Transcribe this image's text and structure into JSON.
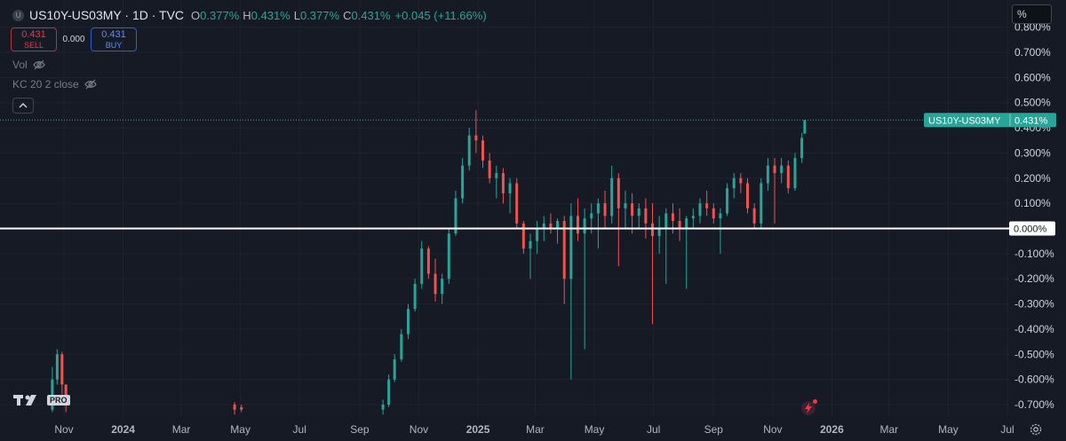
{
  "header": {
    "symbol_badge": "U",
    "title": "US10Y-US03MY · 1D · TVC",
    "open_label": "O",
    "open": "0.377%",
    "high_label": "H",
    "high": "0.431%",
    "low_label": "L",
    "low": "0.377%",
    "close_label": "C",
    "close": "0.431%",
    "change": "+0.045 (+11.66%)"
  },
  "trade": {
    "sell_price": "0.431",
    "sell_label": "SELL",
    "spread": "0.000",
    "buy_price": "0.431",
    "buy_label": "BUY"
  },
  "indicators": [
    {
      "label": "Vol"
    },
    {
      "label": "KC 20 2 close"
    }
  ],
  "unit_selector": "%",
  "price_label": {
    "symbol": "US10Y-US03MY",
    "value": "0.431%"
  },
  "zero_label": "0.000%",
  "logo_text": "PRO",
  "colors": {
    "background": "#161a25",
    "up": "#26a69a",
    "down": "#ef5350",
    "grid": "#1f2330",
    "zero_line": "#ffffff"
  },
  "chart_data": {
    "type": "candlestick",
    "title": "US10Y-US03MY",
    "ylabel": "%",
    "ylim": [
      -0.72,
      0.81
    ],
    "y_ticks": [
      "0.800%",
      "0.700%",
      "0.600%",
      "0.500%",
      "0.400%",
      "0.300%",
      "0.200%",
      "0.100%",
      "-0.100%",
      "-0.200%",
      "-0.300%",
      "-0.400%",
      "-0.500%",
      "-0.600%",
      "-0.700%"
    ],
    "y_tick_values": [
      0.8,
      0.7,
      0.6,
      0.5,
      0.4,
      0.3,
      0.2,
      0.1,
      -0.1,
      -0.2,
      -0.3,
      -0.4,
      -0.5,
      -0.6,
      -0.7
    ],
    "x_ticks": [
      "Nov",
      "2024",
      "Mar",
      "May",
      "Jul",
      "Sep",
      "Nov",
      "2025",
      "Mar",
      "May",
      "Jul",
      "Sep",
      "Nov",
      "2026",
      "Mar",
      "May",
      "Jul"
    ],
    "x_tick_dates": [
      "2023-11-01",
      "2024-01-01",
      "2024-03-01",
      "2024-05-01",
      "2024-07-01",
      "2024-09-01",
      "2024-11-01",
      "2025-01-01",
      "2025-03-01",
      "2025-05-01",
      "2025-07-01",
      "2025-09-01",
      "2025-11-01",
      "2026-01-01",
      "2026-03-01",
      "2026-05-01",
      "2026-07-01"
    ],
    "horizontal_line": 0,
    "last_value": 0.431,
    "grid": true,
    "series": [
      {
        "name": "US10Y-US03MY",
        "data": [
          [
            "2023-10-20",
            -0.72,
            -0.55,
            -0.73,
            -0.6
          ],
          [
            "2023-10-25",
            -0.6,
            -0.48,
            -0.62,
            -0.5
          ],
          [
            "2023-10-30",
            -0.5,
            -0.49,
            -0.66,
            -0.62
          ],
          [
            "2023-11-03",
            -0.62,
            -0.68,
            -0.73,
            -0.7
          ],
          [
            "2024-04-25",
            -0.7,
            -0.69,
            -0.74,
            -0.72
          ],
          [
            "2024-05-02",
            -0.71,
            -0.7,
            -0.73,
            -0.72
          ],
          [
            "2024-09-25",
            -0.72,
            -0.68,
            -0.74,
            -0.7
          ],
          [
            "2024-10-01",
            -0.7,
            -0.58,
            -0.71,
            -0.6
          ],
          [
            "2024-10-07",
            -0.6,
            -0.5,
            -0.61,
            -0.52
          ],
          [
            "2024-10-14",
            -0.52,
            -0.4,
            -0.53,
            -0.42
          ],
          [
            "2024-10-21",
            -0.42,
            -0.3,
            -0.44,
            -0.32
          ],
          [
            "2024-10-28",
            -0.32,
            -0.2,
            -0.33,
            -0.22
          ],
          [
            "2024-11-04",
            -0.22,
            -0.05,
            -0.24,
            -0.08
          ],
          [
            "2024-11-11",
            -0.08,
            -0.07,
            -0.2,
            -0.18
          ],
          [
            "2024-11-18",
            -0.18,
            -0.12,
            -0.29,
            -0.26
          ],
          [
            "2024-11-25",
            -0.26,
            -0.18,
            -0.3,
            -0.2
          ],
          [
            "2024-12-02",
            -0.2,
            0.0,
            -0.22,
            -0.02
          ],
          [
            "2024-12-09",
            -0.02,
            0.15,
            -0.03,
            0.12
          ],
          [
            "2024-12-16",
            0.12,
            0.28,
            0.1,
            0.25
          ],
          [
            "2024-12-23",
            0.25,
            0.4,
            0.23,
            0.37
          ],
          [
            "2024-12-30",
            0.37,
            0.47,
            0.3,
            0.35
          ],
          [
            "2025-01-06",
            0.35,
            0.37,
            0.24,
            0.27
          ],
          [
            "2025-01-13",
            0.27,
            0.3,
            0.18,
            0.2
          ],
          [
            "2025-01-20",
            0.2,
            0.25,
            0.12,
            0.22
          ],
          [
            "2025-01-27",
            0.22,
            0.24,
            0.1,
            0.14
          ],
          [
            "2025-02-03",
            0.14,
            0.2,
            0.06,
            0.18
          ],
          [
            "2025-02-10",
            0.18,
            0.2,
            0.0,
            0.02
          ],
          [
            "2025-02-17",
            0.02,
            0.03,
            -0.1,
            -0.08
          ],
          [
            "2025-02-24",
            -0.08,
            -0.02,
            -0.2,
            -0.05
          ],
          [
            "2025-03-03",
            -0.05,
            0.03,
            -0.1,
            0.0
          ],
          [
            "2025-03-10",
            0.0,
            0.05,
            -0.05,
            0.02
          ],
          [
            "2025-03-17",
            0.02,
            0.06,
            -0.02,
            0.0
          ],
          [
            "2025-03-24",
            0.0,
            0.04,
            -0.06,
            0.03
          ],
          [
            "2025-03-31",
            0.03,
            0.05,
            -0.3,
            -0.2
          ],
          [
            "2025-04-07",
            -0.2,
            0.1,
            -0.6,
            0.05
          ],
          [
            "2025-04-14",
            0.05,
            0.12,
            -0.05,
            -0.02
          ],
          [
            "2025-04-21",
            -0.02,
            0.08,
            -0.48,
            0.04
          ],
          [
            "2025-04-28",
            0.04,
            0.1,
            -0.02,
            0.06
          ],
          [
            "2025-05-05",
            0.06,
            0.12,
            -0.08,
            0.1
          ],
          [
            "2025-05-12",
            0.1,
            0.15,
            0.0,
            0.05
          ],
          [
            "2025-05-19",
            0.05,
            0.25,
            0.02,
            0.2
          ],
          [
            "2025-05-26",
            0.2,
            0.22,
            -0.15,
            0.08
          ],
          [
            "2025-06-02",
            0.08,
            0.15,
            0.0,
            0.1
          ],
          [
            "2025-06-09",
            0.1,
            0.14,
            -0.02,
            0.05
          ],
          [
            "2025-06-16",
            0.05,
            0.1,
            0.0,
            0.08
          ],
          [
            "2025-06-23",
            0.08,
            0.12,
            -0.04,
            0.02
          ],
          [
            "2025-06-30",
            0.02,
            0.1,
            -0.38,
            -0.03
          ],
          [
            "2025-07-07",
            -0.03,
            0.05,
            -0.1,
            0.0
          ],
          [
            "2025-07-14",
            0.0,
            0.08,
            -0.22,
            0.06
          ],
          [
            "2025-07-21",
            0.06,
            0.1,
            -0.02,
            0.03
          ],
          [
            "2025-07-28",
            0.03,
            0.08,
            -0.05,
            0.0
          ],
          [
            "2025-08-04",
            0.0,
            0.05,
            -0.24,
            0.04
          ],
          [
            "2025-08-11",
            0.04,
            0.08,
            0.0,
            0.05
          ],
          [
            "2025-08-18",
            0.05,
            0.12,
            0.02,
            0.1
          ],
          [
            "2025-08-25",
            0.1,
            0.15,
            0.05,
            0.08
          ],
          [
            "2025-09-01",
            0.08,
            0.1,
            0.02,
            0.04
          ],
          [
            "2025-09-08",
            0.04,
            0.08,
            -0.1,
            0.06
          ],
          [
            "2025-09-15",
            0.06,
            0.18,
            0.05,
            0.16
          ],
          [
            "2025-09-22",
            0.16,
            0.22,
            0.12,
            0.2
          ],
          [
            "2025-09-29",
            0.2,
            0.22,
            0.14,
            0.18
          ],
          [
            "2025-10-06",
            0.18,
            0.2,
            0.06,
            0.08
          ],
          [
            "2025-10-13",
            0.08,
            0.1,
            0.0,
            0.02
          ],
          [
            "2025-10-20",
            0.02,
            0.2,
            0.0,
            0.18
          ],
          [
            "2025-10-27",
            0.18,
            0.28,
            0.15,
            0.25
          ],
          [
            "2025-11-03",
            0.25,
            0.28,
            0.02,
            0.22
          ],
          [
            "2025-11-10",
            0.22,
            0.28,
            0.18,
            0.25
          ],
          [
            "2025-11-17",
            0.25,
            0.27,
            0.14,
            0.16
          ],
          [
            "2025-11-24",
            0.16,
            0.3,
            0.15,
            0.28
          ],
          [
            "2025-12-01",
            0.28,
            0.38,
            0.26,
            0.36
          ],
          [
            "2025-12-04",
            0.377,
            0.431,
            0.377,
            0.431
          ]
        ]
      }
    ]
  }
}
